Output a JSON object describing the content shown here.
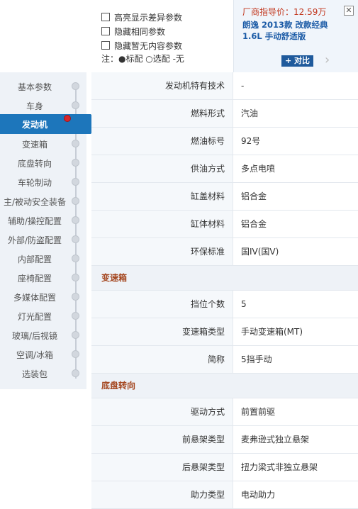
{
  "options": [
    {
      "label": "高亮显示差异参数"
    },
    {
      "label": "隐藏相同参数"
    },
    {
      "label": "隐藏暂无内容参数"
    }
  ],
  "legend": "注：●标配 ○选配 -无",
  "car": {
    "price": "厂商指导价：12.59万",
    "model": "朗逸 2013款 改款经典 1.6L 手动舒适版",
    "compare_label": "+ 对比",
    "close_icon": "close-icon",
    "next_icon": "chevron-right-icon"
  },
  "sidebar": {
    "items": [
      {
        "label": "基本参数"
      },
      {
        "label": "车身"
      },
      {
        "label": "发动机",
        "active": true
      },
      {
        "label": "变速箱"
      },
      {
        "label": "底盘转向"
      },
      {
        "label": "车轮制动"
      },
      {
        "label": "主/被动安全装备"
      },
      {
        "label": "辅助/操控配置"
      },
      {
        "label": "外部/防盗配置"
      },
      {
        "label": "内部配置"
      },
      {
        "label": "座椅配置"
      },
      {
        "label": "多媒体配置"
      },
      {
        "label": "灯光配置"
      },
      {
        "label": "玻璃/后视镜"
      },
      {
        "label": "空调/冰箱"
      },
      {
        "label": "选装包"
      }
    ]
  },
  "engine_rows": [
    {
      "key": "发动机特有技术",
      "value": "-"
    },
    {
      "key": "燃料形式",
      "value": "汽油"
    },
    {
      "key": "燃油标号",
      "value": "92号"
    },
    {
      "key": "供油方式",
      "value": "多点电喷"
    },
    {
      "key": "缸盖材料",
      "value": "铝合金"
    },
    {
      "key": "缸体材料",
      "value": "铝合金"
    },
    {
      "key": "环保标准",
      "value": "国IV(国V)"
    }
  ],
  "gearbox_section": "变速箱",
  "gearbox_rows": [
    {
      "key": "挡位个数",
      "value": "5"
    },
    {
      "key": "变速箱类型",
      "value": "手动变速箱(MT)"
    },
    {
      "key": "简称",
      "value": "5挡手动"
    }
  ],
  "chassis_section": "底盘转向",
  "chassis_rows": [
    {
      "key": "驱动方式",
      "value": "前置前驱"
    },
    {
      "key": "前悬架类型",
      "value": "麦弗逊式独立悬架"
    },
    {
      "key": "后悬架类型",
      "value": "扭力梁式非独立悬架"
    },
    {
      "key": "助力类型",
      "value": "电动助力"
    }
  ]
}
